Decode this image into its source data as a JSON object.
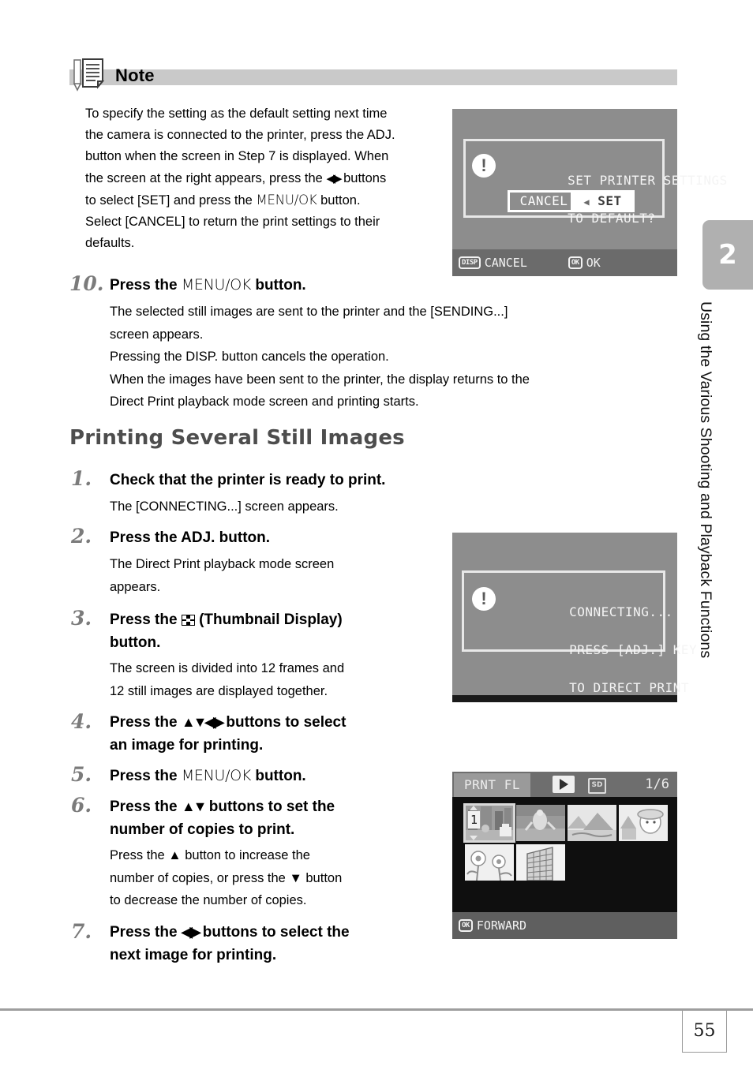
{
  "note": {
    "icon": "note-document-icon",
    "title": "Note",
    "line1": "To specify the setting as the default setting next time",
    "line2": "the camera is connected to the printer, press the ADJ.",
    "line3": "button when the screen in Step 7 is displayed. When",
    "line4_a": "the screen at the right appears, press the ",
    "line4_arrows": "◀▶",
    "line4_b": " buttons",
    "line5_a": "to select [SET] and press the ",
    "line5_menu": "MENU/OK",
    "line5_b": " button.",
    "line6": "Select [CANCEL] to return the print settings to their",
    "line7": "defaults."
  },
  "screen_default": {
    "dialog_line1": "SET PRINTER SETTINGS",
    "dialog_line2": "TO DEFAULT?",
    "option_cancel": "CANCEL",
    "option_set": "SET",
    "cursor": "◀",
    "footer_key_disp": "DISP",
    "footer_label_cancel": "CANCEL",
    "footer_key_ok": "OK",
    "footer_label_ok": "OK"
  },
  "screen_connecting": {
    "line1": "CONNECTING...",
    "line2": "PRESS [ADJ.] KEY",
    "line3": "TO DIRECT PRINT"
  },
  "screen_thumbnails": {
    "mode_badge": "PRNT FL",
    "play_icon": "play-icon",
    "media_icon": "SD",
    "page_counter": "1/6",
    "selected_copy_count": "1",
    "footer_key": "OK",
    "footer_label": "FORWARD",
    "thumbnails": [
      {
        "id": 1,
        "scene": "city-street",
        "selected": true
      },
      {
        "id": 2,
        "scene": "person-running",
        "selected": false
      },
      {
        "id": 3,
        "scene": "mountain-landscape",
        "selected": false
      },
      {
        "id": 4,
        "scene": "portrait-temple",
        "selected": false
      },
      {
        "id": 5,
        "scene": "flowers",
        "selected": false
      },
      {
        "id": 6,
        "scene": "building",
        "selected": false
      }
    ]
  },
  "step10": {
    "number": "10.",
    "title_a": "Press the ",
    "title_menu": "MENU/OK",
    "title_b": " button.",
    "body1": "The selected still images are sent to the printer and the [SENDING...]",
    "body2": "screen appears.",
    "body3": "Pressing the DISP. button cancels the operation.",
    "body4": "When the images have been sent to the printer, the display returns to the",
    "body5": "Direct Print playback mode screen and printing starts."
  },
  "section": {
    "heading": "Printing Several Still Images"
  },
  "steps": [
    {
      "number": "1.",
      "title": "Check that the printer is ready to print.",
      "body": [
        "The [CONNECTING...] screen appears."
      ]
    },
    {
      "number": "2.",
      "title": "Press the ADJ. button.",
      "body": [
        "The Direct Print playback mode screen",
        "appears."
      ]
    },
    {
      "number": "3.",
      "title_a": "Press the ",
      "title_icon": "thumbnail-display-icon",
      "title_b": " (Thumbnail Display)",
      "title_line2": "button.",
      "body": [
        "The screen is divided into 12 frames and",
        "12 still images are displayed together."
      ]
    },
    {
      "number": "4.",
      "title_a": "Press the ",
      "title_arrows": "▲▼◀▶",
      "title_b": " buttons to select",
      "title_line2": "an image for printing."
    },
    {
      "number": "5.",
      "title_a": "Press the ",
      "title_menu": "MENU/OK",
      "title_b": " button."
    },
    {
      "number": "6.",
      "title_a": "Press the ",
      "title_arrows": "▲▼",
      "title_b": " buttons to set the",
      "title_line2": "number of copies to print.",
      "body_l1_a": "Press the ",
      "body_l1_arrow": "▲",
      "body_l1_b": " button to increase the",
      "body_l2_a": "number of copies, or press the ",
      "body_l2_arrow": "▼",
      "body_l2_b": " button",
      "body_l3": "to decrease the number of copies."
    },
    {
      "number": "7.",
      "title_a": "Press the ",
      "title_arrows": "◀▶",
      "title_b": " buttons to select the",
      "title_line2": "next image for printing."
    }
  ],
  "chapter": {
    "number": "2",
    "title": "Using the Various Shooting and Playback Functions"
  },
  "footer": {
    "page_number": "55"
  }
}
